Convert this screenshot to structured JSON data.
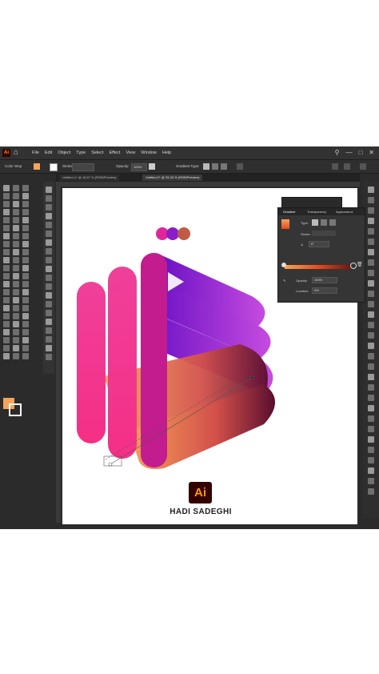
{
  "app": {
    "logo_text": "Ai",
    "menus": [
      "File",
      "Edit",
      "Object",
      "Type",
      "Select",
      "Effect",
      "View",
      "Window",
      "Help"
    ],
    "control_bar": {
      "label": "Color Stop",
      "stroke_label": "Stroke:",
      "opacity_label": "Opacity:",
      "opacity_value": "100%",
      "gradient_type_label": "Gradient Type:"
    },
    "tabs": [
      "Untitled-1* @ 16.67 % (RGB/Preview)",
      "Untitled-2* @ 33.33 % (RGB/Preview)"
    ]
  },
  "gradient_panel": {
    "tabs": [
      "Gradient",
      "Transparency",
      "Appearance"
    ],
    "type_label": "Type:",
    "stroke_label": "Stroke:",
    "angle_value": "0°",
    "opacity_label": "Opacity:",
    "opacity_value": "100%",
    "location_label": "Location:",
    "location_value": "0%"
  },
  "canvas": {
    "badge_text": "Ai",
    "author": "HADI SADEGHI"
  },
  "colors": {
    "ui_bg": "#2b2b2b",
    "brand_dark": "#330000",
    "brand_orange": "#ff9a00",
    "gradient_pink": "#f0409a",
    "gradient_purple": "#7a16c9",
    "gradient_orange": "#f6a35a"
  }
}
